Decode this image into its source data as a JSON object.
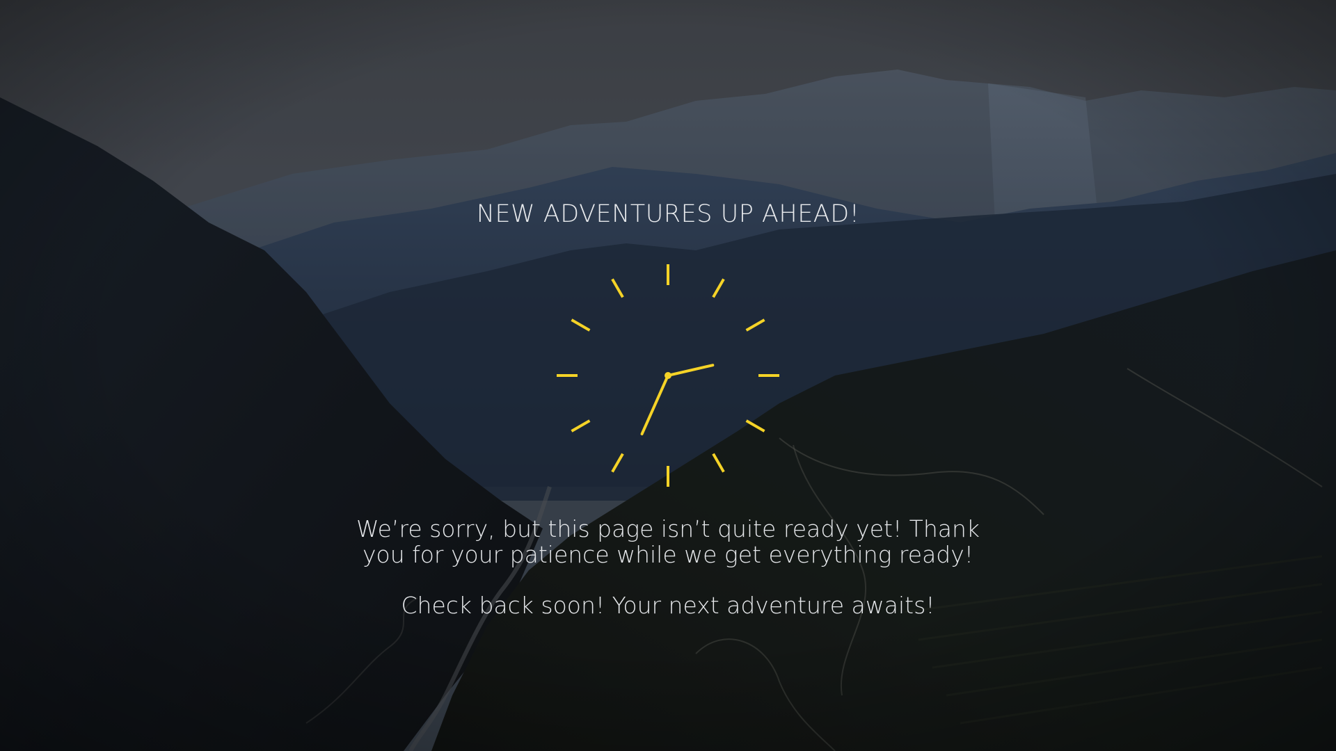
{
  "page": {
    "heading": "NEW ADVENTURES UP AHEAD!",
    "message": "We’re sorry, but this page isn’t quite ready yet! Thank you for your patience while we get everything ready!",
    "sub_message": "Check back soon! Your next adventure awaits!"
  },
  "clock": {
    "icon": "clock-icon",
    "hour": 2,
    "minute": 34
  },
  "colors": {
    "accent": "#f5d327",
    "text": "#e8eaed",
    "sky": "#5c6068",
    "valley_shadow": "#14171b"
  }
}
